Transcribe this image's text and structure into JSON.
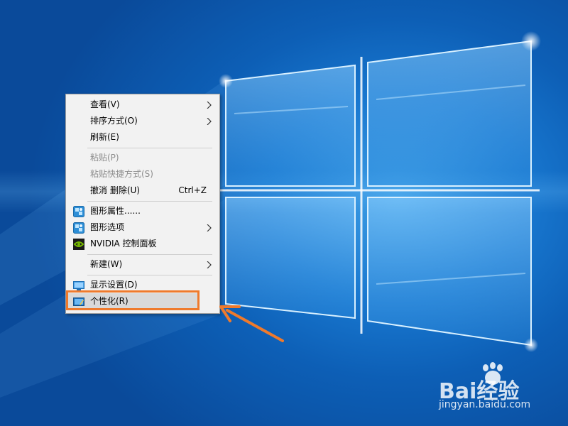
{
  "context_menu": {
    "items": [
      {
        "label": "查看(V)",
        "submenu": true
      },
      {
        "label": "排序方式(O)",
        "submenu": true
      },
      {
        "label": "刷新(E)"
      },
      {
        "label": "粘贴(P)",
        "disabled": true
      },
      {
        "label": "粘贴快捷方式(S)",
        "disabled": true
      },
      {
        "label": "撤消 删除(U)",
        "shortcut": "Ctrl+Z"
      },
      {
        "label": "图形属性......",
        "icon": "intel-graphics-icon"
      },
      {
        "label": "图形选项",
        "icon": "intel-graphics-icon",
        "submenu": true
      },
      {
        "label": "NVIDIA 控制面板",
        "icon": "nvidia-icon"
      },
      {
        "label": "新建(W)",
        "submenu": true
      },
      {
        "label": "显示设置(D)",
        "icon": "display-settings-icon"
      },
      {
        "label": "个性化(R)",
        "icon": "personalize-icon",
        "highlighted": true
      }
    ]
  },
  "watermark": {
    "brand_text": "Bai经验",
    "url": "jingyan.baidu.com"
  },
  "colors": {
    "callout": "#ef7a2c",
    "menu_bg": "#f2f2f2",
    "menu_highlight": "#d9d9d9",
    "desktop_blue": "#1877cf"
  }
}
